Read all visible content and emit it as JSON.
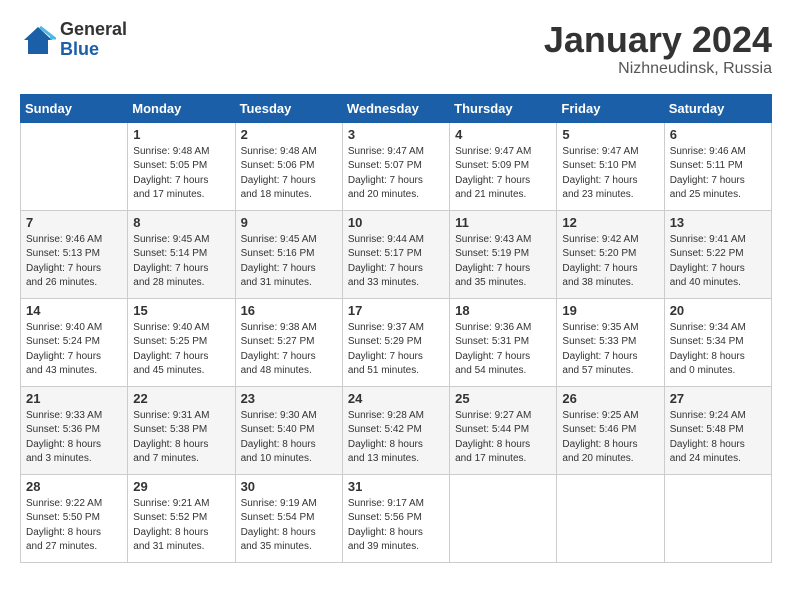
{
  "logo": {
    "general": "General",
    "blue": "Blue"
  },
  "title": {
    "month_year": "January 2024",
    "location": "Nizhneudinsk, Russia"
  },
  "days": [
    "Sunday",
    "Monday",
    "Tuesday",
    "Wednesday",
    "Thursday",
    "Friday",
    "Saturday"
  ],
  "weeks": [
    [
      {
        "date": "",
        "info": ""
      },
      {
        "date": "1",
        "info": "Sunrise: 9:48 AM\nSunset: 5:05 PM\nDaylight: 7 hours\nand 17 minutes."
      },
      {
        "date": "2",
        "info": "Sunrise: 9:48 AM\nSunset: 5:06 PM\nDaylight: 7 hours\nand 18 minutes."
      },
      {
        "date": "3",
        "info": "Sunrise: 9:47 AM\nSunset: 5:07 PM\nDaylight: 7 hours\nand 20 minutes."
      },
      {
        "date": "4",
        "info": "Sunrise: 9:47 AM\nSunset: 5:09 PM\nDaylight: 7 hours\nand 21 minutes."
      },
      {
        "date": "5",
        "info": "Sunrise: 9:47 AM\nSunset: 5:10 PM\nDaylight: 7 hours\nand 23 minutes."
      },
      {
        "date": "6",
        "info": "Sunrise: 9:46 AM\nSunset: 5:11 PM\nDaylight: 7 hours\nand 25 minutes."
      }
    ],
    [
      {
        "date": "7",
        "info": "Sunrise: 9:46 AM\nSunset: 5:13 PM\nDaylight: 7 hours\nand 26 minutes."
      },
      {
        "date": "8",
        "info": "Sunrise: 9:45 AM\nSunset: 5:14 PM\nDaylight: 7 hours\nand 28 minutes."
      },
      {
        "date": "9",
        "info": "Sunrise: 9:45 AM\nSunset: 5:16 PM\nDaylight: 7 hours\nand 31 minutes."
      },
      {
        "date": "10",
        "info": "Sunrise: 9:44 AM\nSunset: 5:17 PM\nDaylight: 7 hours\nand 33 minutes."
      },
      {
        "date": "11",
        "info": "Sunrise: 9:43 AM\nSunset: 5:19 PM\nDaylight: 7 hours\nand 35 minutes."
      },
      {
        "date": "12",
        "info": "Sunrise: 9:42 AM\nSunset: 5:20 PM\nDaylight: 7 hours\nand 38 minutes."
      },
      {
        "date": "13",
        "info": "Sunrise: 9:41 AM\nSunset: 5:22 PM\nDaylight: 7 hours\nand 40 minutes."
      }
    ],
    [
      {
        "date": "14",
        "info": "Sunrise: 9:40 AM\nSunset: 5:24 PM\nDaylight: 7 hours\nand 43 minutes."
      },
      {
        "date": "15",
        "info": "Sunrise: 9:40 AM\nSunset: 5:25 PM\nDaylight: 7 hours\nand 45 minutes."
      },
      {
        "date": "16",
        "info": "Sunrise: 9:38 AM\nSunset: 5:27 PM\nDaylight: 7 hours\nand 48 minutes."
      },
      {
        "date": "17",
        "info": "Sunrise: 9:37 AM\nSunset: 5:29 PM\nDaylight: 7 hours\nand 51 minutes."
      },
      {
        "date": "18",
        "info": "Sunrise: 9:36 AM\nSunset: 5:31 PM\nDaylight: 7 hours\nand 54 minutes."
      },
      {
        "date": "19",
        "info": "Sunrise: 9:35 AM\nSunset: 5:33 PM\nDaylight: 7 hours\nand 57 minutes."
      },
      {
        "date": "20",
        "info": "Sunrise: 9:34 AM\nSunset: 5:34 PM\nDaylight: 8 hours\nand 0 minutes."
      }
    ],
    [
      {
        "date": "21",
        "info": "Sunrise: 9:33 AM\nSunset: 5:36 PM\nDaylight: 8 hours\nand 3 minutes."
      },
      {
        "date": "22",
        "info": "Sunrise: 9:31 AM\nSunset: 5:38 PM\nDaylight: 8 hours\nand 7 minutes."
      },
      {
        "date": "23",
        "info": "Sunrise: 9:30 AM\nSunset: 5:40 PM\nDaylight: 8 hours\nand 10 minutes."
      },
      {
        "date": "24",
        "info": "Sunrise: 9:28 AM\nSunset: 5:42 PM\nDaylight: 8 hours\nand 13 minutes."
      },
      {
        "date": "25",
        "info": "Sunrise: 9:27 AM\nSunset: 5:44 PM\nDaylight: 8 hours\nand 17 minutes."
      },
      {
        "date": "26",
        "info": "Sunrise: 9:25 AM\nSunset: 5:46 PM\nDaylight: 8 hours\nand 20 minutes."
      },
      {
        "date": "27",
        "info": "Sunrise: 9:24 AM\nSunset: 5:48 PM\nDaylight: 8 hours\nand 24 minutes."
      }
    ],
    [
      {
        "date": "28",
        "info": "Sunrise: 9:22 AM\nSunset: 5:50 PM\nDaylight: 8 hours\nand 27 minutes."
      },
      {
        "date": "29",
        "info": "Sunrise: 9:21 AM\nSunset: 5:52 PM\nDaylight: 8 hours\nand 31 minutes."
      },
      {
        "date": "30",
        "info": "Sunrise: 9:19 AM\nSunset: 5:54 PM\nDaylight: 8 hours\nand 35 minutes."
      },
      {
        "date": "31",
        "info": "Sunrise: 9:17 AM\nSunset: 5:56 PM\nDaylight: 8 hours\nand 39 minutes."
      },
      {
        "date": "",
        "info": ""
      },
      {
        "date": "",
        "info": ""
      },
      {
        "date": "",
        "info": ""
      }
    ]
  ]
}
